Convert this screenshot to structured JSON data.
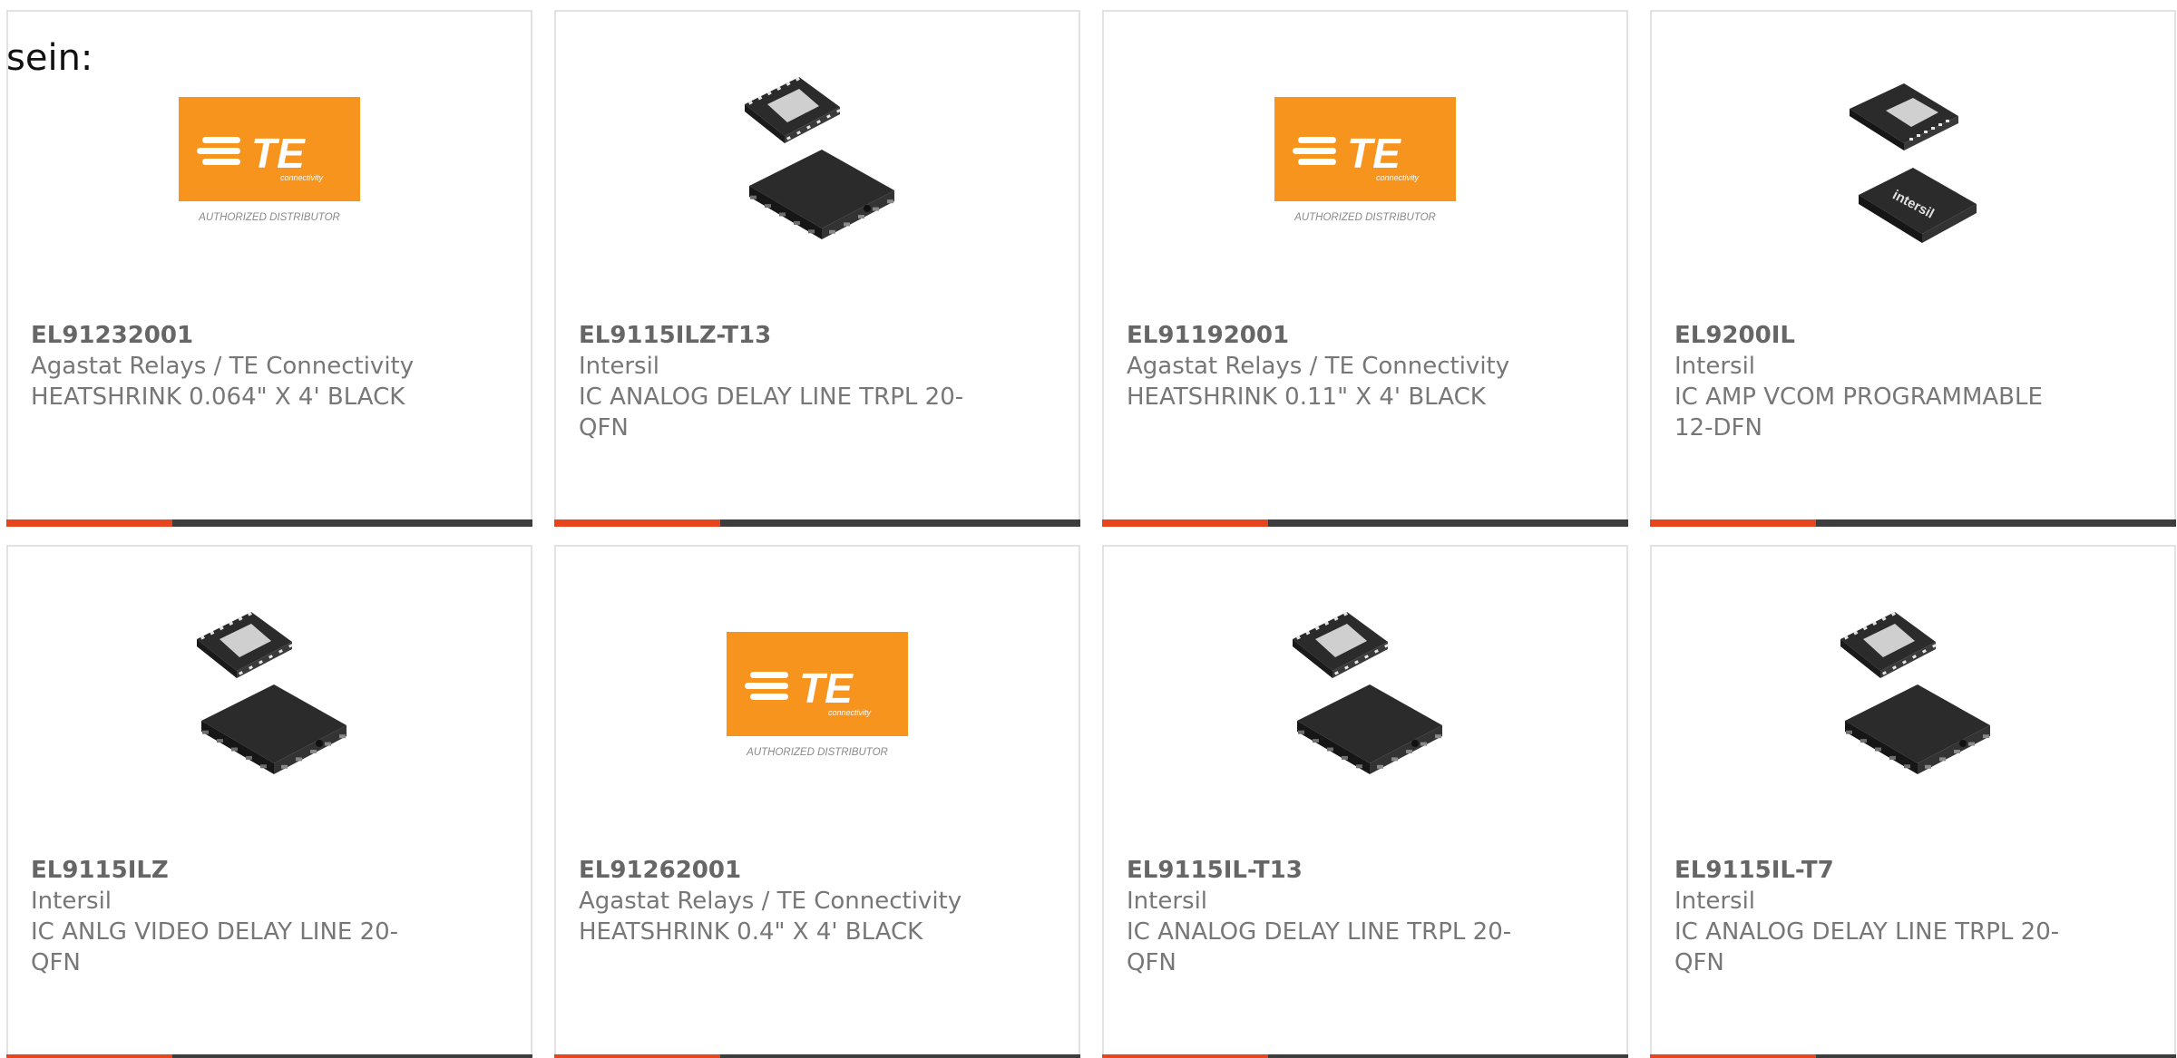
{
  "intro_text": "sein:",
  "colors": {
    "accent": "#e8451f",
    "bar_dark": "#3d3d3d",
    "te_orange": "#f7941d",
    "chip_dark": "#2b2b2b"
  },
  "products": [
    {
      "part_number": "EL91232001",
      "manufacturer": "Agastat Relays / TE Connectivity",
      "description": "HEATSHRINK 0.064\" X 4' BLACK",
      "image": "te-authorized-distributor-logo",
      "image_text": "AUTHORIZED DISTRIBUTOR"
    },
    {
      "part_number": "EL9115ILZ-T13",
      "manufacturer": "Intersil",
      "description": "IC ANALOG DELAY LINE TRPL 20-QFN",
      "image": "qfn-chip-image"
    },
    {
      "part_number": "EL91192001",
      "manufacturer": "Agastat Relays / TE Connectivity",
      "description": "HEATSHRINK 0.11\" X 4' BLACK",
      "image": "te-authorized-distributor-logo",
      "image_text": "AUTHORIZED DISTRIBUTOR"
    },
    {
      "part_number": "EL9200IL",
      "manufacturer": "Intersil",
      "description": "IC AMP VCOM PROGRAMMABLE 12-DFN",
      "image": "dfn-chip-image",
      "image_text": "intersil"
    },
    {
      "part_number": "EL9115ILZ",
      "manufacturer": "Intersil",
      "description": "IC ANLG VIDEO DELAY LINE 20-QFN",
      "image": "qfn-chip-image"
    },
    {
      "part_number": "EL91262001",
      "manufacturer": "Agastat Relays / TE Connectivity",
      "description": "HEATSHRINK 0.4\" X 4' BLACK",
      "image": "te-authorized-distributor-logo",
      "image_text": "AUTHORIZED DISTRIBUTOR"
    },
    {
      "part_number": "EL9115IL-T13",
      "manufacturer": "Intersil",
      "description": "IC ANALOG DELAY LINE TRPL 20-QFN",
      "image": "qfn-chip-image"
    },
    {
      "part_number": "EL9115IL-T7",
      "manufacturer": "Intersil",
      "description": "IC ANALOG DELAY LINE TRPL 20-QFN",
      "image": "qfn-chip-image"
    }
  ]
}
